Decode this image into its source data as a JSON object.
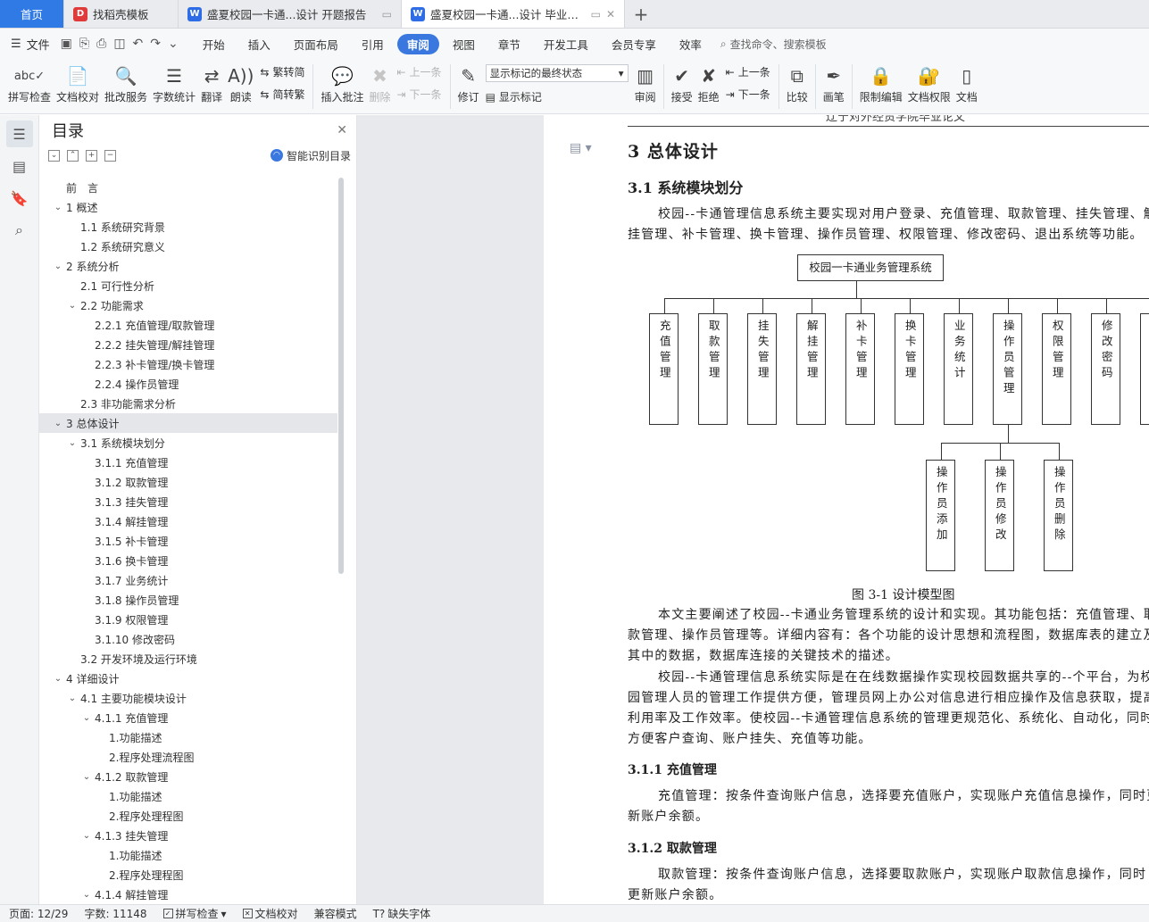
{
  "tabs": [
    {
      "label": "首页",
      "icon": "home"
    },
    {
      "label": "找稻壳模板",
      "icon": "docer-icon"
    },
    {
      "label": "盛夏校园一卡通...设计 开题报告",
      "icon": "writer-doc-icon"
    },
    {
      "label": "盛夏校园一卡通...设计 毕业论文",
      "icon": "writer-doc-icon",
      "active": true
    }
  ],
  "menubar": {
    "file_label": "文件",
    "items": [
      "开始",
      "插入",
      "页面布局",
      "引用",
      "审阅",
      "视图",
      "章节",
      "开发工具",
      "会员专享",
      "效率"
    ],
    "active": "审阅",
    "search_placeholder": "查找命令、搜索模板"
  },
  "ribbon": {
    "spell_check": "拼写检查",
    "doc_proof": "文档校对",
    "batch_service": "批改服务",
    "word_count": "字数统计",
    "translate": "翻译",
    "read_aloud": "朗读",
    "trad_to_simp": "繁转简",
    "simp_to_trad": "简转繁",
    "insert_comment": "插入批注",
    "delete": "删除",
    "prev_comment": "上一条",
    "next_comment": "下一条",
    "revise": "修订",
    "markup_state": "显示标记的最终状态",
    "show_markup": "显示标记",
    "review": "审阅",
    "accept": "接受",
    "reject": "拒绝",
    "prev_change": "上一条",
    "next_change": "下一条",
    "compare": "比较",
    "pen": "画笔",
    "restrict_edit": "限制编辑",
    "doc_permission": "文档权限",
    "doc_more": "文档"
  },
  "toc": {
    "title": "目录",
    "ai_label": "智能识别目录",
    "items": [
      {
        "text": "前　言",
        "level": 0,
        "caret": ""
      },
      {
        "text": "1  概述",
        "level": 0,
        "caret": "v"
      },
      {
        "text": "1.1  系统研究背景",
        "level": 1,
        "caret": ""
      },
      {
        "text": "1.2  系统研究意义",
        "level": 1,
        "caret": ""
      },
      {
        "text": "2  系统分析",
        "level": 0,
        "caret": "v"
      },
      {
        "text": "2.1  可行性分析",
        "level": 1,
        "caret": ""
      },
      {
        "text": "2.2  功能需求",
        "level": 1,
        "caret": "v"
      },
      {
        "text": "2.2.1  充值管理/取款管理",
        "level": 2,
        "caret": ""
      },
      {
        "text": "2.2.2  挂失管理/解挂管理",
        "level": 2,
        "caret": ""
      },
      {
        "text": "2.2.3  补卡管理/换卡管理",
        "level": 2,
        "caret": ""
      },
      {
        "text": "2.2.4  操作员管理",
        "level": 2,
        "caret": ""
      },
      {
        "text": "2.3  非功能需求分析",
        "level": 1,
        "caret": ""
      },
      {
        "text": "3  总体设计",
        "level": 0,
        "caret": "v",
        "selected": true
      },
      {
        "text": "3.1  系统模块划分",
        "level": 1,
        "caret": "v"
      },
      {
        "text": "3.1.1  充值管理",
        "level": 2,
        "caret": ""
      },
      {
        "text": "3.1.2  取款管理",
        "level": 2,
        "caret": ""
      },
      {
        "text": "3.1.3  挂失管理",
        "level": 2,
        "caret": ""
      },
      {
        "text": "3.1.4  解挂管理",
        "level": 2,
        "caret": ""
      },
      {
        "text": "3.1.5  补卡管理",
        "level": 2,
        "caret": ""
      },
      {
        "text": "3.1.6  换卡管理",
        "level": 2,
        "caret": ""
      },
      {
        "text": "3.1.7  业务统计",
        "level": 2,
        "caret": ""
      },
      {
        "text": "3.1.8  操作员管理",
        "level": 2,
        "caret": ""
      },
      {
        "text": "3.1.9  权限管理",
        "level": 2,
        "caret": ""
      },
      {
        "text": "3.1.10  修改密码",
        "level": 2,
        "caret": ""
      },
      {
        "text": "3.2  开发环境及运行环境",
        "level": 1,
        "caret": ""
      },
      {
        "text": "4  详细设计",
        "level": 0,
        "caret": "v"
      },
      {
        "text": "4.1  主要功能模块设计",
        "level": 1,
        "caret": "v"
      },
      {
        "text": "4.1.1  充值管理",
        "level": 2,
        "caret": "v"
      },
      {
        "text": "1.功能描述",
        "level": 3,
        "caret": ""
      },
      {
        "text": "2.程序处理流程图",
        "level": 3,
        "caret": ""
      },
      {
        "text": "4.1.2  取款管理",
        "level": 2,
        "caret": "v"
      },
      {
        "text": "1.功能描述",
        "level": 3,
        "caret": ""
      },
      {
        "text": "2.程序处理程图",
        "level": 3,
        "caret": ""
      },
      {
        "text": "4.1.3  挂失管理",
        "level": 2,
        "caret": "v"
      },
      {
        "text": "1.功能描述",
        "level": 3,
        "caret": ""
      },
      {
        "text": "2.程序处理程图",
        "level": 3,
        "caret": ""
      },
      {
        "text": "4.1.4  解挂管理",
        "level": 2,
        "caret": "v"
      }
    ]
  },
  "document": {
    "running_header": "辽宁对外经贸学院毕业论文",
    "h1": "3  总体设计",
    "h2": "3.1  系统模块划分",
    "para1": [
      "校园--卡通管理信息系统主要实现对用户登录、充值管理、取款管理、挂失管理、解",
      "挂管理、补卡管理、换卡管理、操作员管理、权限管理、修改密码、退出系统等功能。"
    ],
    "diagram": {
      "root": "校园一卡通业务管理系统",
      "modules": [
        "充值管理",
        "取款管理",
        "挂失管理",
        "解挂管理",
        "补卡管理",
        "换卡管理",
        "业务统计",
        "操作员管理",
        "权限管理",
        "修改密码",
        "退出系统"
      ],
      "sub_modules": [
        "操作员添加",
        "操作员修改",
        "操作员删除"
      ]
    },
    "caption": "图 3-1 设计模型图",
    "para2": [
      "本文主要阐述了校园--卡通业务管理系统的设计和实现。其功能包括：充值管理、取",
      "款管理、操作员管理等。详细内容有：各个功能的设计思想和流程图，数据库表的建立及",
      "其中的数据，数据库连接的关键技术的描述。"
    ],
    "para3": [
      "校园--卡通管理信息系统实际是在在线数据操作实现校园数据共享的--个平台，为校",
      "园管理人员的管理工作提供方便，管理员网上办公对信息进行相应操作及信息获取，提高",
      "利用率及工作效率。使校园--卡通管理信息系统的管理更规范化、系统化、自动化，同时",
      "方便客户查询、账户挂失、充值等功能。"
    ],
    "h3_1": "3.1.1  充值管理",
    "para4": [
      "充值管理：按条件查询账户信息，选择要充值账户，实现账户充值信息操作，同时更",
      "新账户余额。"
    ],
    "h3_2": "3.1.2  取款管理",
    "para5": [
      " 取款管理：按条件查询账户信息，选择要取款账户，实现账户取款信息操作，同时",
      "更新账户余额。"
    ]
  },
  "statusbar": {
    "page": "页面: 12/29",
    "words": "字数: 11148",
    "spell": "拼写检查",
    "proof": "文档校对",
    "compat": "兼容模式",
    "missing_font": "缺失字体"
  }
}
